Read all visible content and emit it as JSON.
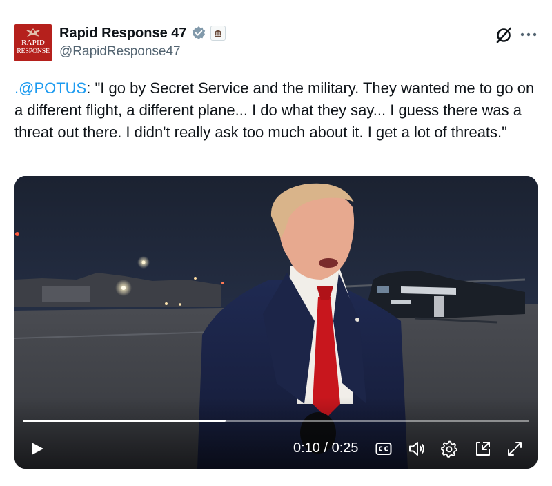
{
  "account": {
    "display_name": "Rapid Response 47",
    "handle": "@RapidResponse47",
    "avatar_text_line1": "RAPID",
    "avatar_text_line2": "RESPONSE",
    "verified_icon": "verified-badge-icon",
    "affiliation_icon": "government-badge-icon"
  },
  "tweet": {
    "mention": ".@POTUS",
    "text": ": \"I go by Secret Service and the military. They wanted me to go on a different flight, a different plane... I do what they say... I guess there was a threat out there. I didn't really ask too much about it. I get a lot of threats.\""
  },
  "video": {
    "current_time": "0:10",
    "duration": "0:25",
    "time_label": "0:10 / 0:25",
    "progress_fraction": 0.4,
    "controls": [
      "play-icon",
      "closed-captions-icon",
      "volume-icon",
      "settings-icon",
      "picture-in-picture-icon",
      "fullscreen-icon"
    ]
  },
  "colors": {
    "link": "#1d9bf0",
    "verified": "#829aab",
    "avatar_bg": "#b5201c",
    "handle": "#536471"
  }
}
